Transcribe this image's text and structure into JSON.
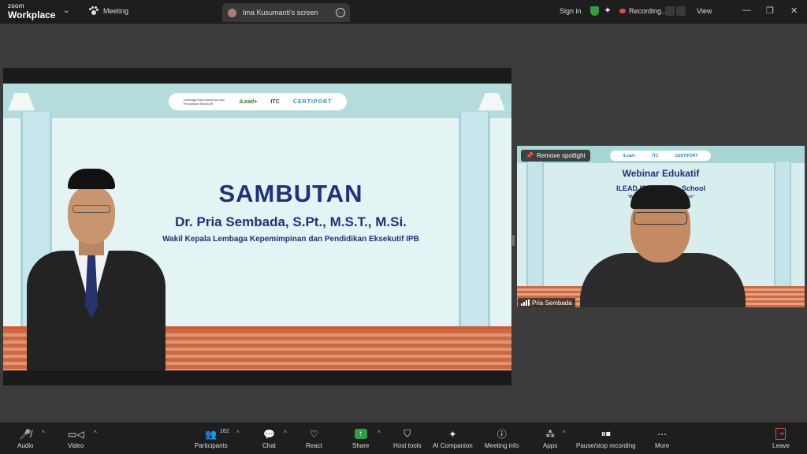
{
  "titlebar": {
    "brand_top": "zoom",
    "brand_bottom": "Workplace",
    "meeting_label": "Meeting",
    "tab_label": "Ima Kusumanti's screen",
    "sign_in": "Sign in",
    "recording_label": "Recording...",
    "view_label": "View"
  },
  "slide": {
    "logo_texts": [
      "Lembaga Kepemimpinan dan Pendidikan Eksekutif",
      "iLead+",
      "ITC",
      "CERTIPORT"
    ],
    "title": "SAMBUTAN",
    "name": "Dr. Pria Sembada, S.Pt., M.S.T., M.Si.",
    "role": "Wakil Kepala Lembaga Kepemimpinan dan Pendidikan Eksekutif IPB"
  },
  "video_tile": {
    "remove_spotlight": "Remove spotlight",
    "bg_title": "Webinar Edukatif",
    "bg_subtitle": "ILEAD IPB Goes to School",
    "bg_tagline": "\"Boost Your ... ational Certification\"",
    "participant_name": "Pria Sembada"
  },
  "toolbar": {
    "audio": "Audio",
    "video": "Video",
    "participants": "Participants",
    "participants_count": "162",
    "chat": "Chat",
    "react": "React",
    "share": "Share",
    "host_tools": "Host tools",
    "ai_companion": "AI Companion",
    "meeting_info": "Meeting info",
    "apps": "Apps",
    "pause_stop_recording": "Pause/stop recording",
    "more": "More",
    "leave": "Leave"
  },
  "colors": {
    "slide_navy": "#21307a",
    "share_green": "#2ea043",
    "leave_red": "#e04a4a"
  }
}
